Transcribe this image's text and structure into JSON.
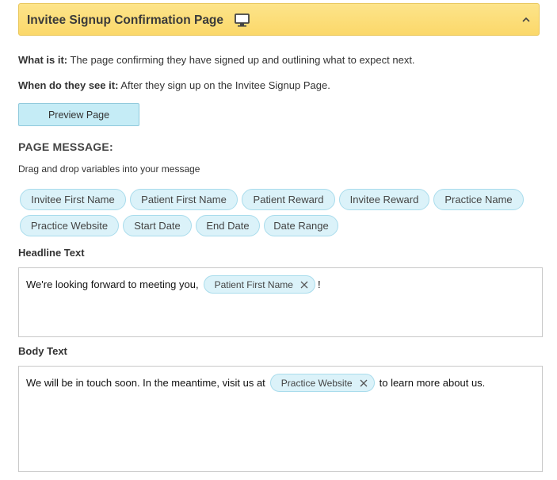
{
  "header": {
    "title": "Invitee Signup Confirmation Page",
    "icon": "monitor-icon",
    "toggle_icon": "chevron-up-icon",
    "background_color": "#fcdf7c"
  },
  "info": {
    "what_label": "What is it:",
    "what_text": " The page confirming they have signed up and outlining what to expect next.",
    "when_label": "When do they see it:",
    "when_text": " After they sign up on the Invitee Signup Page."
  },
  "preview_button": {
    "label": "Preview Page"
  },
  "page_message": {
    "title": "PAGE MESSAGE:",
    "hint": "Drag and drop variables into your message"
  },
  "variables": [
    "Invitee First Name",
    "Patient First Name",
    "Patient Reward",
    "Invitee Reward",
    "Practice Name",
    "Practice Website",
    "Start Date",
    "End Date",
    "Date Range"
  ],
  "headline": {
    "label": "Headline Text",
    "before": "We're looking forward to meeting you,",
    "chip": "Patient First Name",
    "after": "!"
  },
  "body": {
    "label": "Body Text",
    "before": "We will be in touch soon. In the meantime, visit us at",
    "chip": "Practice Website",
    "after": "to learn more about us."
  },
  "colors": {
    "chip_background": "#dbf2f9",
    "chip_border": "#a9dcec",
    "button_background": "#c5ecf6"
  }
}
